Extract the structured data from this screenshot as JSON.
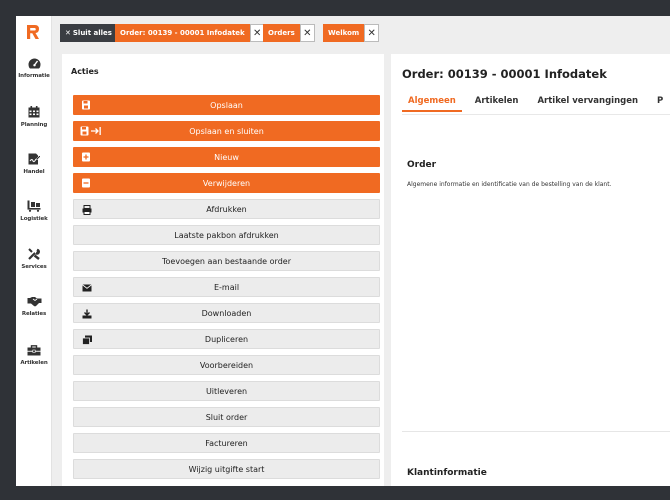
{
  "sidebar": {
    "items": [
      {
        "label": "Informatie",
        "icon": "gauge-icon"
      },
      {
        "label": "Planning",
        "icon": "calendar-icon"
      },
      {
        "label": "Handel",
        "icon": "signature-icon"
      },
      {
        "label": "Logistiek",
        "icon": "pallet-truck-icon"
      },
      {
        "label": "Services",
        "icon": "tools-icon"
      },
      {
        "label": "Relaties",
        "icon": "handshake-icon"
      },
      {
        "label": "Artikelen",
        "icon": "toolbox-icon"
      }
    ]
  },
  "tabs": {
    "close_all_label": "Sluit alles",
    "items": [
      {
        "label": "Order: 00139 - 00001 Infodatek",
        "close": "✕"
      },
      {
        "label": "Orders",
        "close": "✕"
      },
      {
        "label": "Welkom",
        "close": "✕"
      }
    ]
  },
  "acties": {
    "title": "Acties",
    "buttons": [
      {
        "label": "Opslaan"
      },
      {
        "label": "Opslaan en sluiten"
      },
      {
        "label": "Nieuw"
      },
      {
        "label": "Verwijderen"
      },
      {
        "label": "Afdrukken"
      },
      {
        "label": "Laatste pakbon afdrukken"
      },
      {
        "label": "Toevoegen aan bestaande order"
      },
      {
        "label": "E-mail"
      },
      {
        "label": "Downloaden"
      },
      {
        "label": "Dupliceren"
      },
      {
        "label": "Voorbereiden"
      },
      {
        "label": "Uitleveren"
      },
      {
        "label": "Sluit order"
      },
      {
        "label": "Factureren"
      },
      {
        "label": "Wijzig uitgifte start"
      }
    ]
  },
  "detail": {
    "title": "Order: 00139 - 00001 Infodatek",
    "tabs": [
      {
        "label": "Algemeen"
      },
      {
        "label": "Artikelen"
      },
      {
        "label": "Artikel vervangingen"
      },
      {
        "label": "P"
      }
    ],
    "order_section": {
      "title": "Order",
      "description": "Algemene informatie en identificatie van de bestelling van de klant."
    },
    "klant_section": {
      "title": "Klantinformatie"
    }
  },
  "colors": {
    "accent": "#f06a22",
    "dark": "#3a3d42"
  }
}
